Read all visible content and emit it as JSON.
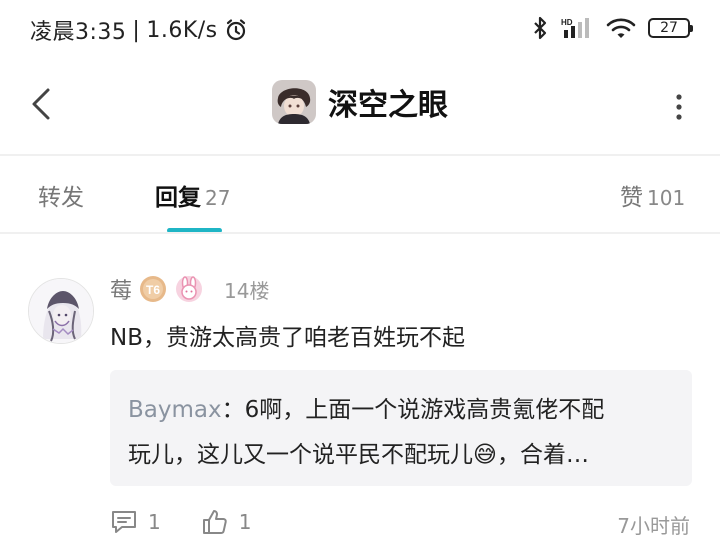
{
  "status_bar": {
    "time": "凌晨3:35",
    "speed": "1.6K/s",
    "battery": "27",
    "network_label": "HD"
  },
  "header": {
    "title": "深空之眼"
  },
  "tabs": [
    {
      "label": "转发",
      "count": ""
    },
    {
      "label": "回复",
      "count": "27"
    },
    {
      "label": "赞",
      "count": "101"
    }
  ],
  "comment": {
    "username": "莓",
    "badge_text": "T6",
    "floor": "14楼",
    "text": "NB，贵游太高贵了咱老百姓玩不起",
    "reply": {
      "author": "Baymax",
      "separator": "：",
      "line1": "6啊，上面一个说游戏高贵氪佬不配",
      "line2_prefix": "玩儿，这儿又一个说平民不配玩儿",
      "emoji": "😅",
      "line2_suffix": "，合着…"
    },
    "reply_count": "1",
    "like_count": "1",
    "time": "7小时前"
  },
  "colors": {
    "accent": "#1fb5c5",
    "reply_author": "#8a93a0",
    "badge_gold": "#e7b98a",
    "badge_pink": "#f2a7c0"
  }
}
